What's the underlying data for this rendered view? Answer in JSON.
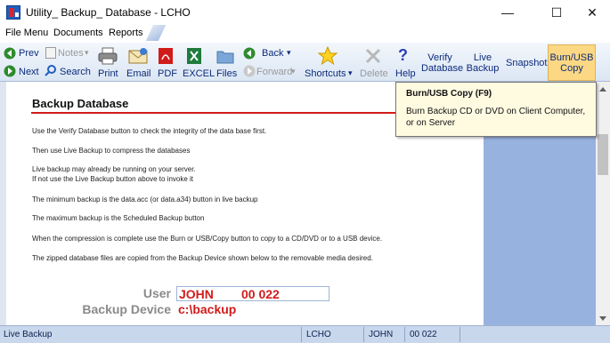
{
  "window": {
    "title": "Utility_ Backup_ Database - LCHO",
    "minimize_glyph": "—",
    "maximize_glyph": "☐",
    "close_glyph": "✕"
  },
  "menu": {
    "file": "File Menu",
    "documents": "Documents",
    "reports": "Reports"
  },
  "toolbar": {
    "prev": "Prev",
    "next": "Next",
    "notes": "Notes",
    "search": "Search",
    "print": "Print",
    "email": "Email",
    "pdf": "PDF",
    "excel": "EXCEL",
    "files": "Files",
    "back": "Back",
    "forward": "Forward",
    "shortcuts": "Shortcuts",
    "delete": "Delete",
    "help": "Help",
    "verify_line1": "Verify",
    "verify_line2": "Database",
    "live_line1": "Live",
    "live_line2": "Backup",
    "snapshot": "Snapshot",
    "burn_line1": "Burn/USB",
    "burn_line2": "Copy",
    "dropdown_glyph": "▾"
  },
  "tooltip": {
    "title": "Burn/USB Copy (F9)",
    "body": "Burn Backup CD or DVD on Client Computer, or on Server"
  },
  "content": {
    "heading": "Backup Database",
    "lines": [
      "Use the Verify Database button to check the integrity of the data base first.",
      "Then use Live Backup to compress the databases",
      "Live backup may already be running on your server.",
      "If not use the Live Backup button above to invoke it",
      "The minimum backup is the data.acc (or data.a34) button in live backup",
      "The maximum backup is the Scheduled Backup button",
      "When the compression is complete use the Burn or USB/Copy button to copy to a CD/DVD or to a USB device.",
      "The zipped database files are copied from the Backup Device shown below to the removable media desired."
    ],
    "user_label": "User",
    "user_value": "JOHN        00 022",
    "device_label": "Backup Device",
    "device_value": "c:\\backup"
  },
  "statusbar": {
    "mode": "Live Backup",
    "company": "LCHO",
    "user": "JOHN",
    "id": "00 022"
  },
  "colors": {
    "accent_red": "#d11b1b",
    "panel_blue": "#98b2e0",
    "tooltip_bg": "#fffbe1",
    "burn_highlight": "#fcd884"
  }
}
